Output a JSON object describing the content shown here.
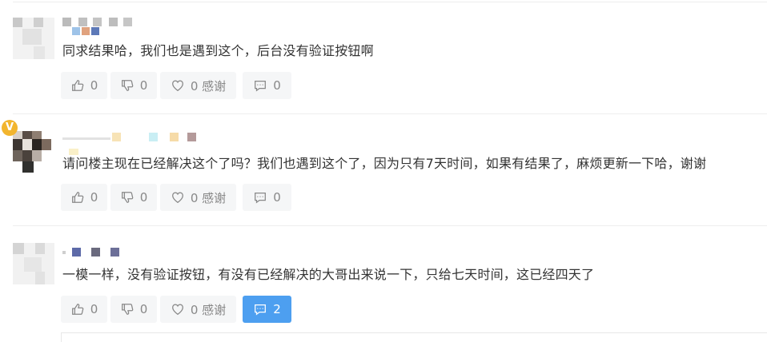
{
  "colors": {
    "background": "#ffffff",
    "button_bg": "#f5f6f7",
    "button_text": "#888888",
    "active_button_bg": "#4d9ff0",
    "badge": "#f2b52e"
  },
  "comments": [
    {
      "text": "同求结果哈，我们也是遇到这个，后台没有验证按钮啊",
      "like_count": "0",
      "dislike_count": "0",
      "thanks_label": "0 感谢",
      "reply_count": "0",
      "badge_text": ""
    },
    {
      "text": "请问楼主现在已经解决这个了吗？我们也遇到这个了，因为只有7天时间，如果有结果了，麻烦更新一下哈，谢谢",
      "like_count": "0",
      "dislike_count": "0",
      "thanks_label": "0 感谢",
      "reply_count": "0",
      "badge_text": "V"
    },
    {
      "text": "一模一样，没有验证按钮，有没有已经解决的大哥出来说一下，只给七天时间，这已经四天了",
      "like_count": "0",
      "dislike_count": "0",
      "thanks_label": "0 感谢",
      "reply_count": "2",
      "badge_text": ""
    }
  ],
  "icons": {
    "like": "thumbs-up-icon",
    "dislike": "thumbs-down-icon",
    "thanks": "heart-icon",
    "reply": "comment-bubble-icon"
  }
}
